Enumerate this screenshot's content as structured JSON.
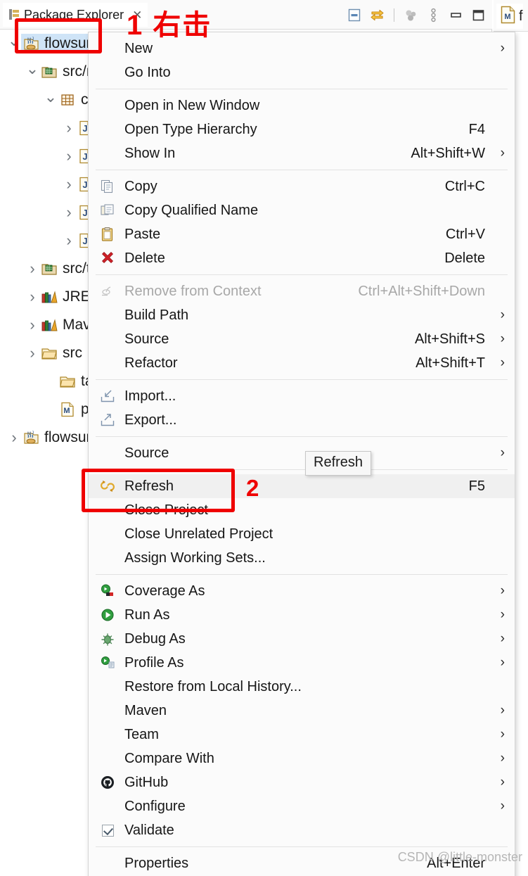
{
  "view": {
    "tab_title": "Package Explorer",
    "close_glyph": "✕",
    "toolbar_icons": [
      {
        "name": "collapse-all-icon"
      },
      {
        "name": "link-with-editor-icon"
      },
      {
        "name": "separator"
      },
      {
        "name": "focus-on-active-task-icon"
      },
      {
        "name": "view-menu-icon"
      },
      {
        "name": "minimize-icon"
      },
      {
        "name": "maximize-icon"
      }
    ]
  },
  "editor": {
    "tab_label": "f",
    "tab_icon": "maven-pom-icon"
  },
  "tree": {
    "items": [
      {
        "label": "flowsur",
        "icon": "java-project-icon",
        "indent": 0,
        "arrow": "open",
        "selected": true
      },
      {
        "label": "src/m",
        "icon": "source-folder-icon",
        "indent": 1,
        "arrow": "open",
        "selected": false
      },
      {
        "label": "co",
        "icon": "package-icon",
        "indent": 2,
        "arrow": "open",
        "selected": false
      },
      {
        "label": "",
        "icon": "java-file-icon",
        "indent": 3,
        "arrow": "closed",
        "selected": false
      },
      {
        "label": "",
        "icon": "java-file-icon",
        "indent": 3,
        "arrow": "closed",
        "selected": false
      },
      {
        "label": "",
        "icon": "java-file-icon",
        "indent": 3,
        "arrow": "closed",
        "selected": false
      },
      {
        "label": "",
        "icon": "java-file-icon",
        "indent": 3,
        "arrow": "closed",
        "selected": false
      },
      {
        "label": "",
        "icon": "java-file-icon",
        "indent": 3,
        "arrow": "closed",
        "selected": false
      },
      {
        "label": "src/t",
        "icon": "source-folder-icon",
        "indent": 1,
        "arrow": "closed",
        "selected": false
      },
      {
        "label": "JRE S",
        "icon": "library-icon",
        "indent": 1,
        "arrow": "closed",
        "selected": false
      },
      {
        "label": "Mav",
        "icon": "library-icon",
        "indent": 1,
        "arrow": "closed",
        "selected": false
      },
      {
        "label": "src",
        "icon": "folder-icon",
        "indent": 1,
        "arrow": "closed",
        "selected": false
      },
      {
        "label": "targ",
        "icon": "folder-icon",
        "indent": 2,
        "arrow": "none",
        "selected": false
      },
      {
        "label": "pom",
        "icon": "maven-pom-icon",
        "indent": 2,
        "arrow": "none",
        "selected": false
      },
      {
        "label": "flowsur",
        "icon": "java-project-icon",
        "indent": 0,
        "arrow": "closed",
        "selected": false
      }
    ]
  },
  "context_menu": {
    "items": [
      {
        "type": "item",
        "label": "New",
        "accel": "",
        "icon": "",
        "submenu": true,
        "disabled": false,
        "highlighted": false
      },
      {
        "type": "item",
        "label": "Go Into",
        "accel": "",
        "icon": "",
        "submenu": false,
        "disabled": false,
        "highlighted": false
      },
      {
        "type": "separator"
      },
      {
        "type": "item",
        "label": "Open in New Window",
        "accel": "",
        "icon": "",
        "submenu": false,
        "disabled": false,
        "highlighted": false
      },
      {
        "type": "item",
        "label": "Open Type Hierarchy",
        "accel": "F4",
        "icon": "",
        "submenu": false,
        "disabled": false,
        "highlighted": false
      },
      {
        "type": "item",
        "label": "Show In",
        "accel": "Alt+Shift+W",
        "icon": "",
        "submenu": true,
        "disabled": false,
        "highlighted": false
      },
      {
        "type": "separator"
      },
      {
        "type": "item",
        "label": "Copy",
        "accel": "Ctrl+C",
        "icon": "copy-icon",
        "submenu": false,
        "disabled": false,
        "highlighted": false
      },
      {
        "type": "item",
        "label": "Copy Qualified Name",
        "accel": "",
        "icon": "copy-qualified-name-icon",
        "submenu": false,
        "disabled": false,
        "highlighted": false
      },
      {
        "type": "item",
        "label": "Paste",
        "accel": "Ctrl+V",
        "icon": "paste-icon",
        "submenu": false,
        "disabled": false,
        "highlighted": false
      },
      {
        "type": "item",
        "label": "Delete",
        "accel": "Delete",
        "icon": "delete-icon",
        "submenu": false,
        "disabled": false,
        "highlighted": false
      },
      {
        "type": "separator"
      },
      {
        "type": "item",
        "label": "Remove from Context",
        "accel": "Ctrl+Alt+Shift+Down",
        "icon": "remove-from-context-icon",
        "submenu": false,
        "disabled": true,
        "highlighted": false
      },
      {
        "type": "item",
        "label": "Build Path",
        "accel": "",
        "icon": "",
        "submenu": true,
        "disabled": false,
        "highlighted": false
      },
      {
        "type": "item",
        "label": "Source",
        "accel": "Alt+Shift+S",
        "icon": "",
        "submenu": true,
        "disabled": false,
        "highlighted": false
      },
      {
        "type": "item",
        "label": "Refactor",
        "accel": "Alt+Shift+T",
        "icon": "",
        "submenu": true,
        "disabled": false,
        "highlighted": false
      },
      {
        "type": "separator"
      },
      {
        "type": "item",
        "label": "Import...",
        "accel": "",
        "icon": "import-icon",
        "submenu": false,
        "disabled": false,
        "highlighted": false
      },
      {
        "type": "item",
        "label": "Export...",
        "accel": "",
        "icon": "export-icon",
        "submenu": false,
        "disabled": false,
        "highlighted": false
      },
      {
        "type": "separator"
      },
      {
        "type": "item",
        "label": "Source",
        "accel": "",
        "icon": "",
        "submenu": true,
        "disabled": false,
        "highlighted": false
      },
      {
        "type": "separator"
      },
      {
        "type": "item",
        "label": "Refresh",
        "accel": "F5",
        "icon": "refresh-icon",
        "submenu": false,
        "disabled": false,
        "highlighted": true
      },
      {
        "type": "item",
        "label": "Close Project",
        "accel": "",
        "icon": "",
        "submenu": false,
        "disabled": false,
        "highlighted": false
      },
      {
        "type": "item",
        "label": "Close Unrelated Project",
        "accel": "",
        "icon": "",
        "submenu": false,
        "disabled": false,
        "highlighted": false
      },
      {
        "type": "item",
        "label": "Assign Working Sets...",
        "accel": "",
        "icon": "",
        "submenu": false,
        "disabled": false,
        "highlighted": false
      },
      {
        "type": "separator"
      },
      {
        "type": "item",
        "label": "Coverage As",
        "accel": "",
        "icon": "coverage-as-icon",
        "submenu": true,
        "disabled": false,
        "highlighted": false
      },
      {
        "type": "item",
        "label": "Run As",
        "accel": "",
        "icon": "run-as-icon",
        "submenu": true,
        "disabled": false,
        "highlighted": false
      },
      {
        "type": "item",
        "label": "Debug As",
        "accel": "",
        "icon": "debug-as-icon",
        "submenu": true,
        "disabled": false,
        "highlighted": false
      },
      {
        "type": "item",
        "label": "Profile As",
        "accel": "",
        "icon": "profile-as-icon",
        "submenu": true,
        "disabled": false,
        "highlighted": false
      },
      {
        "type": "item",
        "label": "Restore from Local History...",
        "accel": "",
        "icon": "",
        "submenu": false,
        "disabled": false,
        "highlighted": false
      },
      {
        "type": "item",
        "label": "Maven",
        "accel": "",
        "icon": "",
        "submenu": true,
        "disabled": false,
        "highlighted": false
      },
      {
        "type": "item",
        "label": "Team",
        "accel": "",
        "icon": "",
        "submenu": true,
        "disabled": false,
        "highlighted": false
      },
      {
        "type": "item",
        "label": "Compare With",
        "accel": "",
        "icon": "",
        "submenu": true,
        "disabled": false,
        "highlighted": false
      },
      {
        "type": "item",
        "label": "GitHub",
        "accel": "",
        "icon": "github-icon",
        "submenu": true,
        "disabled": false,
        "highlighted": false
      },
      {
        "type": "item",
        "label": "Configure",
        "accel": "",
        "icon": "",
        "submenu": true,
        "disabled": false,
        "highlighted": false
      },
      {
        "type": "item",
        "label": "Validate",
        "accel": "",
        "icon": "checkbox-checked-icon",
        "submenu": false,
        "disabled": false,
        "highlighted": false
      },
      {
        "type": "separator"
      },
      {
        "type": "item",
        "label": "Properties",
        "accel": "Alt+Enter",
        "icon": "",
        "submenu": false,
        "disabled": false,
        "highlighted": false
      }
    ]
  },
  "tooltip": {
    "text": "Refresh"
  },
  "annotations": {
    "step1_text": "1 右击",
    "step2_text": "2",
    "color": "#ef0000"
  },
  "watermark": {
    "text": "CSDN @little-monster"
  }
}
